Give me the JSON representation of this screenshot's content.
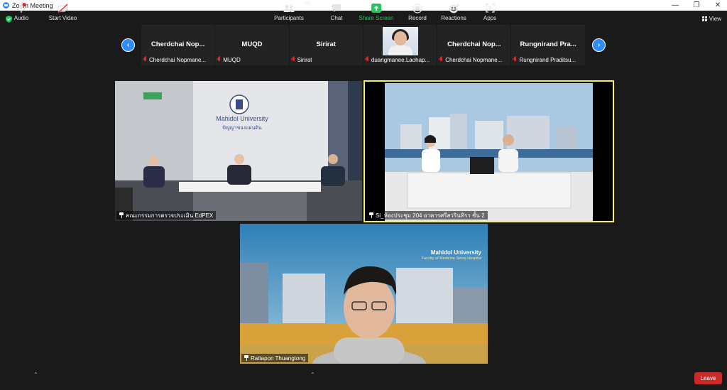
{
  "window": {
    "title": "Zoom Meeting"
  },
  "view_button": {
    "label": "View"
  },
  "strip": {
    "tiles": [
      {
        "name": "Cherdchai  Nop...",
        "footer": "Cherdchai Nopmane..."
      },
      {
        "name": "MUQD",
        "footer": "MUQD"
      },
      {
        "name": "Sirirat",
        "footer": "Sirirat"
      },
      {
        "name": "",
        "footer": "duangmanee.Laohap..."
      },
      {
        "name": "Cherdchai  Nop...",
        "footer": "Cherdchai Nopmane..."
      },
      {
        "name": "Rungnirand  Pra...",
        "footer": "Rungnirand Praditsu..."
      }
    ]
  },
  "videos": {
    "v1": {
      "label": "คณะกรรมการตรวจประเมิน EdPEX",
      "sign_title": "Mahidol University",
      "sign_sub": "ปัญญาของแผ่นดิน"
    },
    "v2": {
      "label": "Si_ห้องประชุม 204 อาคารศรีสวรินทิรา ชั้น 2"
    },
    "v3": {
      "label": "Rattapon Thuangtong",
      "banner_title": "Mahidol University",
      "banner_sub": "Faculty of Medicine Siriraj Hospital"
    }
  },
  "toolbar": {
    "audio": "Audio",
    "start_video": "Start Video",
    "participants": "Participants",
    "participants_count": "35",
    "chat": "Chat",
    "share_screen": "Share Screen",
    "record": "Record",
    "reactions": "Reactions",
    "apps": "Apps",
    "leave": "Leave"
  }
}
